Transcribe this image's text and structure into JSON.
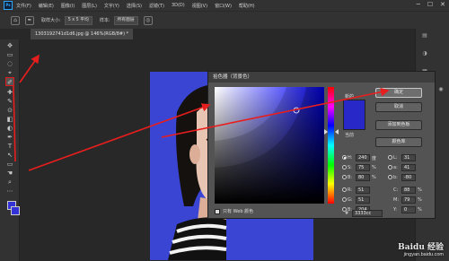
{
  "menubar": {
    "logo": "Ps",
    "items": [
      "文件(F)",
      "编辑(E)",
      "图像(I)",
      "图层(L)",
      "文字(Y)",
      "选择(S)",
      "滤镜(T)",
      "3D(D)",
      "视图(V)",
      "窗口(W)",
      "帮助(H)"
    ],
    "window_controls": [
      "─",
      "☐",
      "✕"
    ]
  },
  "options": {
    "sample_size_label": "取样大小:",
    "sample_size_value": "5 x 5 平均",
    "sample_label": "样本:",
    "sample_value": "所有图层"
  },
  "document": {
    "tab_title": "1303192741d1d6.jpg @ 146%(RGB/8#) *"
  },
  "toolbar": {
    "tool_glyphs": [
      "✥",
      "▭",
      "◌",
      "⌖",
      "✐",
      "✚",
      "✎",
      "⊙",
      "◧",
      "◐",
      "✒",
      "T",
      "↖",
      "▭",
      "☚",
      "⌕",
      "⋯"
    ]
  },
  "color_picker": {
    "title": "拾色器（背景色）",
    "new_label": "新的",
    "current_label": "当前",
    "ok_label": "确定",
    "cancel_label": "取消",
    "add_swatch_label": "添加到色板",
    "libraries_label": "颜色库",
    "only_web_label": "只有 Web 颜色",
    "hsb": [
      {
        "label": "H:",
        "value": "240",
        "unit": "度",
        "selected": true
      },
      {
        "label": "S:",
        "value": "75",
        "unit": "%",
        "selected": false
      },
      {
        "label": "B:",
        "value": "80",
        "unit": "%",
        "selected": false
      }
    ],
    "rgb": [
      {
        "label": "R:",
        "value": "51",
        "selected": false
      },
      {
        "label": "G:",
        "value": "51",
        "selected": false
      },
      {
        "label": "B:",
        "value": "204",
        "selected": false
      }
    ],
    "lab": [
      {
        "label": "L:",
        "value": "31"
      },
      {
        "label": "a:",
        "value": "41"
      },
      {
        "label": "b:",
        "value": "-80"
      }
    ],
    "cmyk": [
      {
        "label": "C:",
        "value": "88",
        "unit": "%"
      },
      {
        "label": "M:",
        "value": "79",
        "unit": "%"
      },
      {
        "label": "Y:",
        "value": "0",
        "unit": "%"
      },
      {
        "label": "K:",
        "value": "0",
        "unit": "%"
      }
    ],
    "hex_label": "#",
    "hex_value": "3333cc",
    "hue_color": "#0000ff",
    "new_color": "#2828c8"
  },
  "colors": {
    "photo_bg": "#3a45d4",
    "arrow": "#e81e1e"
  },
  "watermark": {
    "logo": "Baidu 经验",
    "url": "jingyan.baidu.com"
  }
}
